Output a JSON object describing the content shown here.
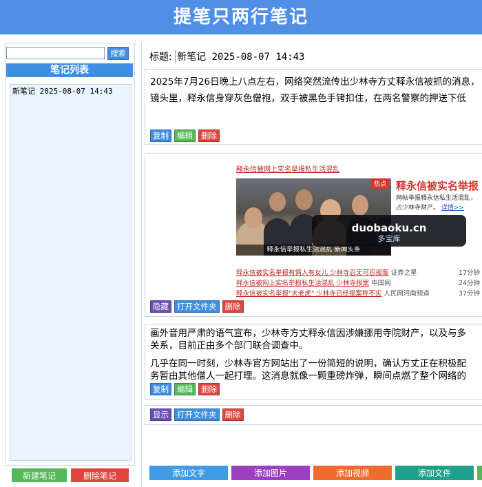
{
  "app": {
    "title": "提笔只两行笔记"
  },
  "sidebar": {
    "search_button": "搜索",
    "list_header": "笔记列表",
    "notes": [
      "新笔记 2025-08-07 14:43"
    ],
    "new_button": "新建笔记",
    "delete_button": "删除笔记"
  },
  "editor": {
    "title_label": "标题:",
    "title_value": "新笔记 2025-08-07 14:43",
    "blocks": [
      {
        "type": "text",
        "paragraphs": [
          "2025年7月26日晚上八点左右，网络突然流传出少林寺方丈释永信被抓的消息，",
          "镜头里，释永信身穿灰色僧袍，双手被黑色手铐扣住，在两名警察的押送下低"
        ],
        "buttons": [
          "复制",
          "编辑",
          "删除"
        ]
      },
      {
        "type": "image",
        "image": {
          "headline": "释永信被网上实名举报私生活混乱",
          "tag": "热点",
          "side_title": "释永信被实名举报",
          "side_desc_1": "网帖举报释永信私生活混乱，",
          "side_desc_2": "占少林寺财产。",
          "more_link": "详情>>",
          "caption": "释永信举报私生活混乱 新闻头条",
          "links": [
            {
              "text": "释永信被实名举报有情人有女儿 少林寺忍无可忍报案",
              "source": "证券之星",
              "time": "17分钟"
            },
            {
              "text": "释永信被网上实名举报私生活混乱 少林寺报案",
              "source": "中国网",
              "time": "24分钟"
            },
            {
              "text": "释永信被实名举报\"大老虎\" 少林寺已经报案称不实",
              "source": "人民网河南频道",
              "time": "37分钟"
            }
          ]
        },
        "buttons": [
          "隐藏",
          "打开文件夹",
          "删除"
        ]
      },
      {
        "type": "text",
        "paragraphs": [
          "画外音用严肃的语气宣布，少林寺方丈释永信因涉嫌挪用寺院财产，以及与多",
          "关系，目前正由多个部门联合调查中。",
          "几乎在同一时刻，少林寺官方网站出了一份简短的说明，确认方丈正在积极配",
          "务暂由其他僧人一起打理。这消息就像一颗重磅炸弹，瞬间点燃了整个网络的"
        ],
        "buttons": [
          "复制",
          "编辑",
          "删除"
        ]
      },
      {
        "type": "collapsed",
        "buttons": [
          "显示",
          "打开文件夹",
          "删除"
        ]
      }
    ]
  },
  "add_buttons": {
    "text": "添加文字",
    "image": "添加图片",
    "video": "添加视频",
    "file": "添加文件"
  },
  "watermark": {
    "domain": "duobaoku.cn",
    "name": "多宝库"
  },
  "colors": {
    "header_bg": "#4f8fe6",
    "blue": "#3f8fe0",
    "green": "#55b85a",
    "red": "#e0463f",
    "purple": "#6a4fb6",
    "add_text": "#3f9be6",
    "add_image": "#9c3fc0",
    "add_video": "#ef6c2d",
    "add_file": "#1fa08a"
  }
}
